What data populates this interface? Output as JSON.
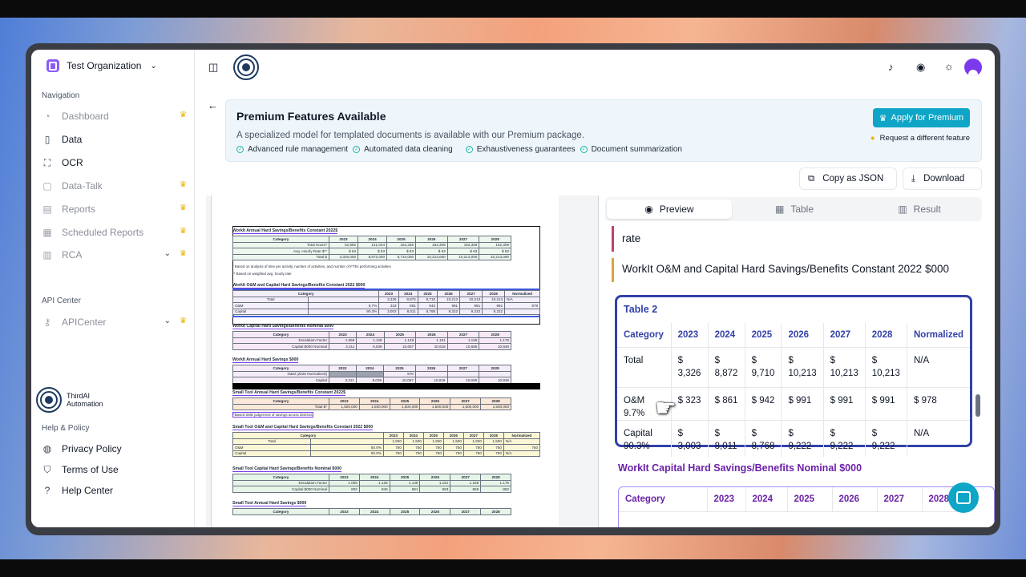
{
  "sidebar": {
    "org_name": "Test Organization",
    "nav_label": "Navigation",
    "nav_items": [
      {
        "label": "Dashboard",
        "icon": "gauge-icon",
        "premium": true,
        "enabled": false
      },
      {
        "label": "Data",
        "icon": "file-icon",
        "premium": false,
        "enabled": true
      },
      {
        "label": "OCR",
        "icon": "scan-icon",
        "premium": false,
        "enabled": true
      },
      {
        "label": "Data-Talk",
        "icon": "chat-icon",
        "premium": true,
        "enabled": false
      },
      {
        "label": "Reports",
        "icon": "file-text-icon",
        "premium": true,
        "enabled": false
      },
      {
        "label": "Scheduled Reports",
        "icon": "calendar-icon",
        "premium": true,
        "enabled": false
      },
      {
        "label": "RCA",
        "icon": "chart-icon",
        "premium": true,
        "enabled": false
      }
    ],
    "api_label": "API Center",
    "api_item": "APICenter",
    "brand": {
      "line1": "ThirdAI",
      "line2": "Automation"
    },
    "help_label": "Help & Policy",
    "help_items": [
      "Privacy Policy",
      "Terms of Use",
      "Help Center"
    ]
  },
  "banner": {
    "title": "Premium Features Available",
    "description": "A specialized model for templated documents is available with our Premium package.",
    "features": [
      "Advanced rule management",
      "Automated data cleaning",
      "Exhaustiveness guarantees",
      "Document summarization"
    ],
    "apply_label": "Apply for Premium",
    "request_label": "Request a different feature"
  },
  "actions": {
    "copy_json": "Copy as JSON",
    "download": "Download"
  },
  "tabs": [
    "Preview",
    "Table",
    "Result"
  ],
  "preview": {
    "rate_text": "rate",
    "heading": "WorkIt O&M and Capital Hard Savings/Benefits Constant 2022 $000",
    "table2": {
      "title": "Table 2",
      "headers": [
        "Category",
        "2023",
        "2024",
        "2025",
        "2026",
        "2027",
        "2028",
        "Normalized"
      ],
      "rows": [
        [
          "Total",
          "$ 3,326",
          "$ 8,872",
          "$ 9,710",
          "$ 10,213",
          "$ 10,213",
          "$ 10,213",
          "N/A"
        ],
        [
          "O&M 9.7%",
          "$ 323",
          "$ 861",
          "$ 942",
          "$ 991",
          "$ 991",
          "$ 991",
          "$ 978"
        ],
        [
          "Capital 90.3%",
          "$ 3,003",
          "$ 8,011",
          "$ 8,768",
          "$ 9,222",
          "$ 9,222",
          "$ 9,222",
          "N/A"
        ]
      ]
    },
    "section3_title": "WorkIt Capital Hard Savings/Benefits Nominal $000",
    "table3_headers": [
      "Category",
      "2023",
      "2024",
      "2025",
      "2026",
      "2027",
      "2028"
    ]
  },
  "document": {
    "titles": [
      "WorkIt Annual Hard Savings/Benefits Constant 2022$",
      "WorkIt O&M and Capital Hard Savings/Benefits Constant 2022 $000",
      "WorkIt Capital Hard Savings/Benefits Nominal $000",
      "WorkIt Annual Hard Savings $000",
      "Small Tool Annual Hard Savings/Benefits Constant 2022$",
      "Small Tool O&M and Capital Hard Savings/Benefits Constant 2022 $000",
      "Small Tool Capital Hard Savings/Benefits Nominal $000",
      "Small Tool Annual Hard Savings $000"
    ],
    "notes": [
      "* Based on analysis of time per activity, number of activities, and number of FTEs performing activities",
      "** Based on weighted avg. hourly rate",
      "*Based SME judgement of savings across Districts"
    ],
    "header_row": [
      "Category",
      "2023",
      "2024",
      "2025",
      "2026",
      "2027",
      "2028"
    ],
    "t1_rows": [
      [
        "Total Hours*",
        "52,892",
        "141,044",
        "154,335",
        "162,309",
        "162,309",
        "162,309"
      ],
      [
        "Avg. Hourly Rate $**",
        "$ 63",
        "$ 63",
        "$ 63",
        "$ 63",
        "$ 63",
        "$ 63"
      ],
      [
        "Total $",
        "3,326,000",
        "8,872,000",
        "9,710,000",
        "10,213,000",
        "10,213,000",
        "10,213,000"
      ]
    ],
    "t2_rows": [
      [
        "Total",
        "",
        "3,326",
        "8,872",
        "9,710",
        "10,213",
        "10,213",
        "10,213",
        "N/A"
      ],
      [
        "O&M",
        "9.7%",
        "323",
        "861",
        "942",
        "991",
        "991",
        "991",
        "978"
      ],
      [
        "Capital",
        "90.3%",
        "3,003",
        "8,011",
        "8,768",
        "9,222",
        "9,222",
        "9,222",
        ""
      ]
    ],
    "t3_rows": [
      [
        "Escalation Factor",
        "1.069",
        "1.128",
        "1.148",
        "1.151",
        "1.159",
        "1.176"
      ],
      [
        "Capital $000 Nominal",
        "3,211",
        "9,039",
        "10,067",
        "10,618",
        "10,685",
        "10,848"
      ]
    ],
    "t4_rows": [
      [
        "O&M (2025 Normalized)",
        "",
        "",
        "978",
        "",
        "",
        ""
      ],
      [
        "Capital",
        "3,211",
        "9,039",
        "10,067",
        "10,618",
        "10,685",
        "10,848"
      ]
    ],
    "t5_rows": [
      [
        "Total $*",
        "1,500,000",
        "1,500,000",
        "1,500,000",
        "1,500,000",
        "1,500,000",
        "1,500,000"
      ]
    ],
    "t6_rows": [
      [
        "Total",
        "",
        "1,500",
        "1,500",
        "1,500",
        "1,500",
        "1,500",
        "1,500",
        "N/A"
      ],
      [
        "O&M",
        "50.0%",
        "750",
        "750",
        "750",
        "750",
        "750",
        "750",
        "750"
      ],
      [
        "Capital",
        "50.0%",
        "750",
        "750",
        "750",
        "750",
        "750",
        "750",
        "N/A"
      ]
    ],
    "t7_rows": [
      [
        "Escalation Factor",
        "1.069",
        "1.128",
        "1.148",
        "1.151",
        "1.159",
        "1.176"
      ],
      [
        "Capital $000 Nominal",
        "802",
        "846",
        "861",
        "863",
        "869",
        "882"
      ]
    ],
    "normalized_label": "Normalized"
  },
  "colors": {
    "accent": "#0ea5c6",
    "table_border": "#3341a8",
    "section_purple": "#6b21a8",
    "crown": "#eab308"
  }
}
